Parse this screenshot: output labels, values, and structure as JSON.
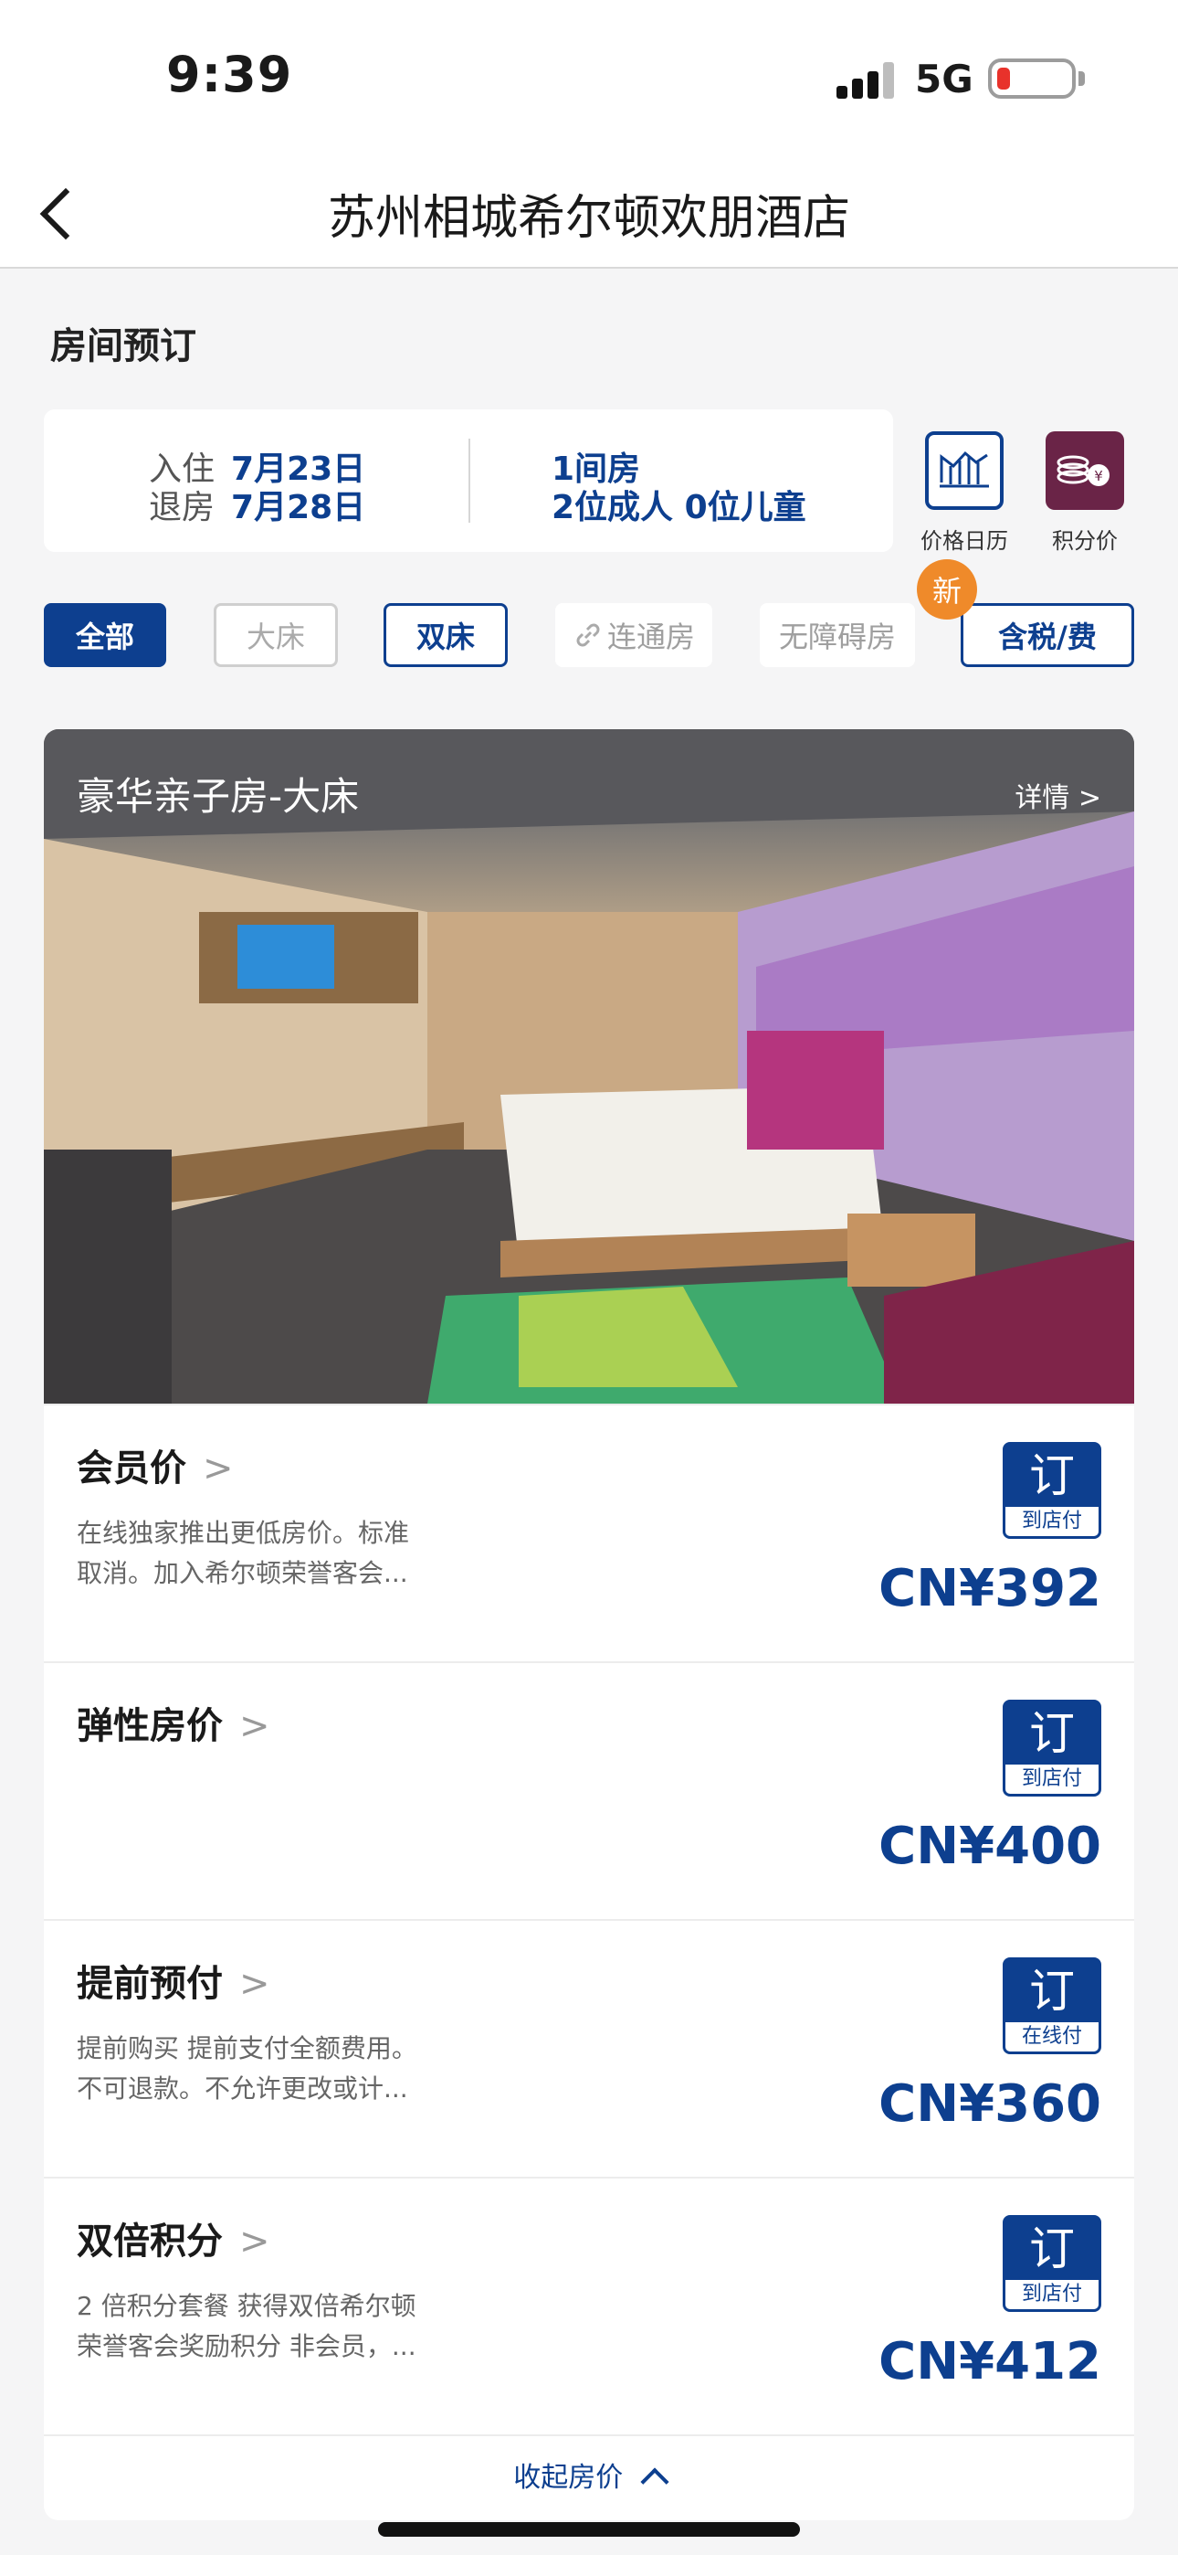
{
  "status_bar": {
    "time": "9:39",
    "network": "5G"
  },
  "header": {
    "title": "苏州相城希尔顿欢朋酒店"
  },
  "section_title": "房间预订",
  "stay": {
    "checkin_label": "入住",
    "checkin_value": "7月23日",
    "checkout_label": "退房",
    "checkout_value": "7月28日",
    "rooms": "1间房",
    "guests": "2位成人 0位儿童"
  },
  "tools": {
    "price_calendar": "价格日历",
    "points_price": "积分价"
  },
  "filters": [
    {
      "label": "全部"
    },
    {
      "label": "大床"
    },
    {
      "label": "双床"
    },
    {
      "label": "连通房"
    },
    {
      "label": "无障碍房"
    },
    {
      "label": "含税/费"
    }
  ],
  "new_badge": "新",
  "room": {
    "name": "豪华亲子房-大床",
    "detail_link": "详情 >"
  },
  "rates": [
    {
      "name": "会员价",
      "chevron": ">",
      "desc_line1": "在线独家推出更低房价。标准",
      "desc_line2": "取消。加入希尔顿荣誉客会...",
      "book": "订",
      "pay": "到店付",
      "price": "CN¥392"
    },
    {
      "name": "弹性房价",
      "chevron": ">",
      "desc_line1": "",
      "desc_line2": "",
      "book": "订",
      "pay": "到店付",
      "price": "CN¥400"
    },
    {
      "name": "提前预付",
      "chevron": ">",
      "desc_line1": "提前购买 提前支付全额费用。",
      "desc_line2": "不可退款。不允许更改或计...",
      "book": "订",
      "pay": "在线付",
      "price": "CN¥360"
    },
    {
      "name": "双倍积分",
      "chevron": ">",
      "desc_line1": "2 倍积分套餐 获得双倍希尔顿",
      "desc_line2": "荣誉客会奖励积分 非会员，...",
      "book": "订",
      "pay": "到店付",
      "price": "CN¥412"
    }
  ],
  "collapse_label": "收起房价",
  "colors": {
    "brand_blue": "#0d3f8f",
    "points_purple": "#6a2447",
    "new_orange": "#ef8a2a"
  }
}
